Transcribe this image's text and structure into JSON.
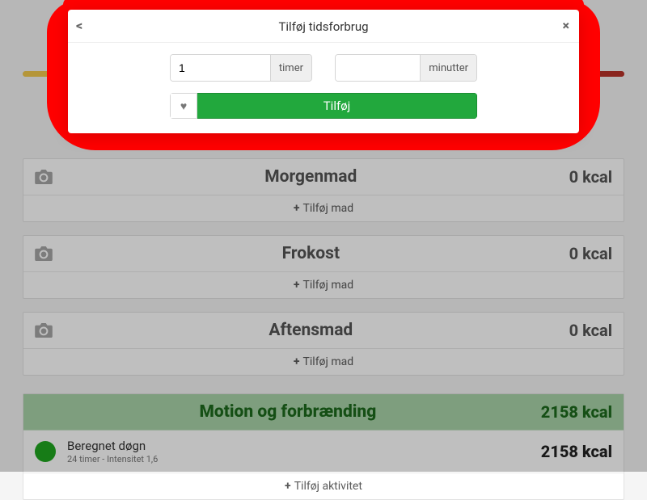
{
  "modal": {
    "title": "Tilføj tidsforbrug",
    "hours_value": "1",
    "hours_unit": "timer",
    "minutes_value": "",
    "minutes_unit": "minutter",
    "add_label": "Tilføj"
  },
  "meals": [
    {
      "title": "Morgenmad",
      "kcal": "0 kcal",
      "add_label": "Tilføj mad"
    },
    {
      "title": "Frokost",
      "kcal": "0 kcal",
      "add_label": "Tilføj mad"
    },
    {
      "title": "Aftensmad",
      "kcal": "0 kcal",
      "add_label": "Tilføj mad"
    }
  ],
  "exercise": {
    "title": "Motion og forbrænding",
    "kcal": "2158 kcal",
    "activity_name": "Beregnet døgn",
    "activity_sub": "24 timer - Intensitet 1,6",
    "activity_kcal": "2158 kcal",
    "add_label": "Tilføj aktivitet"
  }
}
